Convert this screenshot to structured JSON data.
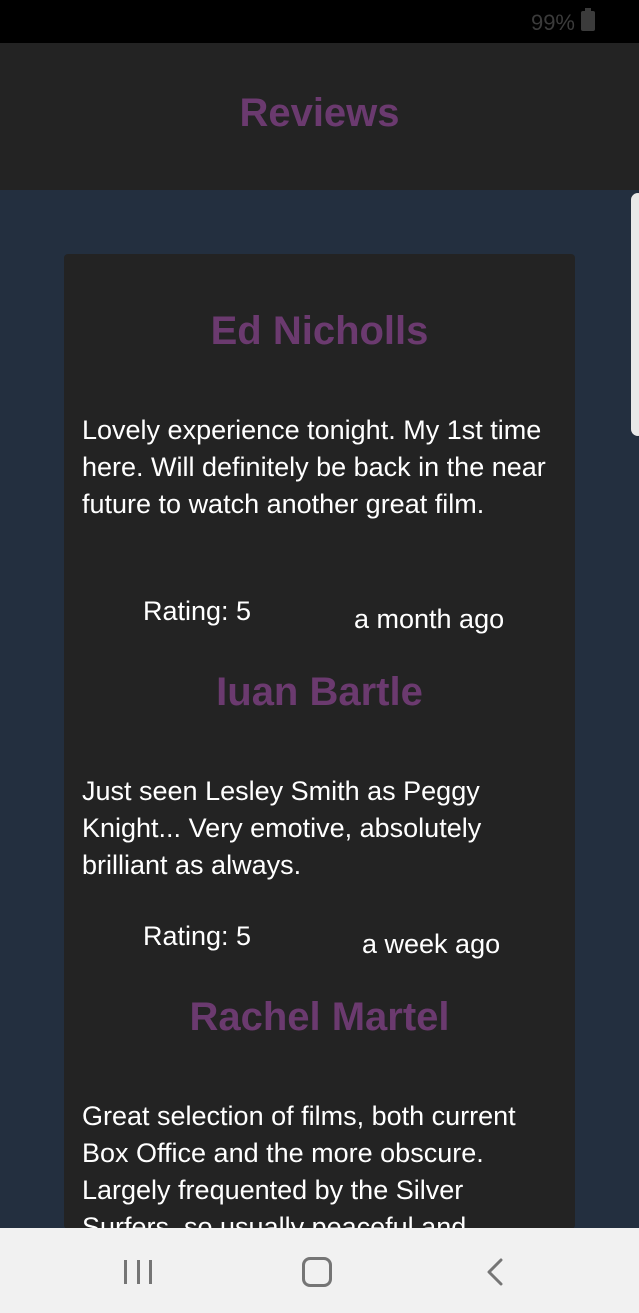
{
  "status_bar": {
    "battery": "99%"
  },
  "header": {
    "title": "Reviews"
  },
  "reviews": [
    {
      "name": "Ed Nicholls",
      "text": "Lovely experience tonight. My 1st time here. Will definitely be back in the near future to watch another great film.",
      "rating": "Rating: 5",
      "date": "a month ago"
    },
    {
      "name": "Iuan Bartle",
      "text": "Just seen Lesley Smith as Peggy Knight... Very emotive, absolutely brilliant as always.",
      "rating": "Rating: 5",
      "date": "a week ago"
    },
    {
      "name": "Rachel Martel",
      "text": "Great selection of films, both current Box Office and the more obscure. Largely frequented by the Silver Surfers, so usually peaceful and"
    }
  ],
  "colors": {
    "accent": "#6b3a6f",
    "background": "#232f3f",
    "card": "#232323"
  },
  "nav_bar": {
    "icons": [
      "recents-icon",
      "home-icon",
      "back-icon"
    ]
  }
}
